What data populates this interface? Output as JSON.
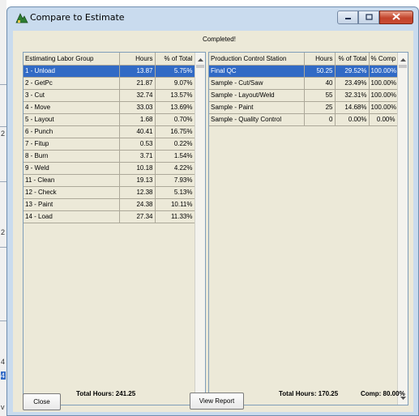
{
  "window": {
    "title": "Compare to Estimate"
  },
  "status_label": "Completed!",
  "left_table": {
    "columns": [
      "Estimating Labor Group",
      "Hours",
      "% of Total"
    ],
    "rows": [
      [
        "1 - Unload",
        "13.87",
        "5.75%"
      ],
      [
        "2 - GetPc",
        "21.87",
        "9.07%"
      ],
      [
        "3 - Cut",
        "32.74",
        "13.57%"
      ],
      [
        "4 - Move",
        "33.03",
        "13.69%"
      ],
      [
        "5 - Layout",
        "1.68",
        "0.70%"
      ],
      [
        "6 - Punch",
        "40.41",
        "16.75%"
      ],
      [
        "7 - Fitup",
        "0.53",
        "0.22%"
      ],
      [
        "8 - Burn",
        "3.71",
        "1.54%"
      ],
      [
        "9 - Weld",
        "10.18",
        "4.22%"
      ],
      [
        "11 - Clean",
        "19.13",
        "7.93%"
      ],
      [
        "12 - Check",
        "12.38",
        "5.13%"
      ],
      [
        "13 - Paint",
        "24.38",
        "10.11%"
      ],
      [
        "14 - Load",
        "27.34",
        "11.33%"
      ]
    ],
    "selected_row": 0
  },
  "right_table": {
    "columns": [
      "Production Control Station",
      "Hours",
      "% of Total",
      "% Comp"
    ],
    "rows": [
      [
        "Final QC",
        "50.25",
        "29.52%",
        "100.00%"
      ],
      [
        "Sample - Cut/Saw",
        "40",
        "23.49%",
        "100.00%"
      ],
      [
        "Sample - Layout/Weld",
        "55",
        "32.31%",
        "100.00%"
      ],
      [
        "Sample - Paint",
        "25",
        "14.68%",
        "100.00%"
      ],
      [
        "Sample - Quality Control",
        "0",
        "0.00%",
        "0.00%"
      ]
    ],
    "selected_row": 0
  },
  "footer": {
    "close_label": "Close",
    "left_total": "Total Hours: 241.25",
    "view_report_label": "View Report",
    "right_total": "Total Hours: 170.25",
    "comp": "Comp: 80.00%"
  },
  "background_glyphs": [
    "2",
    "2",
    "4",
    "4",
    "v"
  ],
  "icons": {
    "app": "compare-estimate-icon",
    "minimize": "minimize-icon",
    "maximize": "maximize-icon",
    "close": "close-icon"
  },
  "colors": {
    "selection": "#316ac5",
    "client_bg": "#ece9d8",
    "close_button": "#c3442c"
  }
}
